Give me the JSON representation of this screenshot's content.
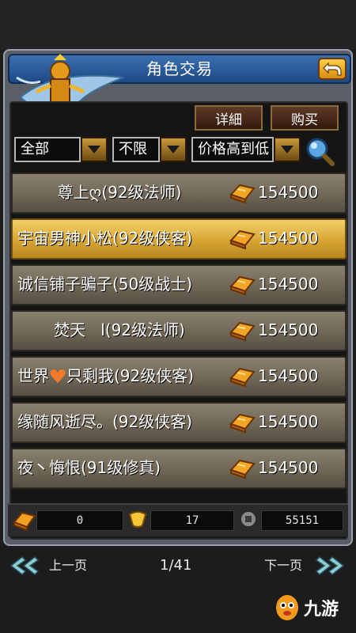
{
  "window": {
    "title": "角色交易"
  },
  "toolbar": {
    "detail_label": "详細",
    "buy_label": "购买"
  },
  "filters": {
    "category": "全部",
    "level": "不限",
    "sort": "价格高到低"
  },
  "listings": [
    {
      "name": "尊上ღ(92级法师)",
      "price": "154500",
      "selected": false,
      "centered": true
    },
    {
      "name": "宇宙男神小松(92级侠客)",
      "price": "154500",
      "selected": true,
      "centered": false
    },
    {
      "name": "诚信铺子骗子(50级战士)",
      "price": "154500",
      "selected": false,
      "centered": false
    },
    {
      "name": "焚天   l(92级法师)",
      "price": "154500",
      "selected": false,
      "centered": true
    },
    {
      "name": "只剩我(92级侠客)",
      "prefix": "世界",
      "price": "154500",
      "selected": false,
      "centered": false
    },
    {
      "name": "缘随风逝尽。(92级侠客)",
      "price": "154500",
      "selected": false,
      "centered": false
    },
    {
      "name": "夜丶悔恨(91级修真)",
      "price": "154500",
      "selected": false,
      "centered": false
    }
  ],
  "resources": {
    "gold": "0",
    "ingot": "17",
    "coins": "55151"
  },
  "pagination": {
    "prev_label": "上一页",
    "page_indicator": "1/41",
    "next_label": "下一页"
  },
  "watermark": {
    "text": "九游"
  },
  "colors": {
    "accent": "#e2b23c",
    "title_bar": "#2f5f9e"
  },
  "icons": [
    "back-arrow-icon",
    "search-icon",
    "gold-bar-icon",
    "ingot-icon",
    "coin-icon",
    "heart-icon",
    "double-chevron-left-icon",
    "double-chevron-right-icon"
  ]
}
